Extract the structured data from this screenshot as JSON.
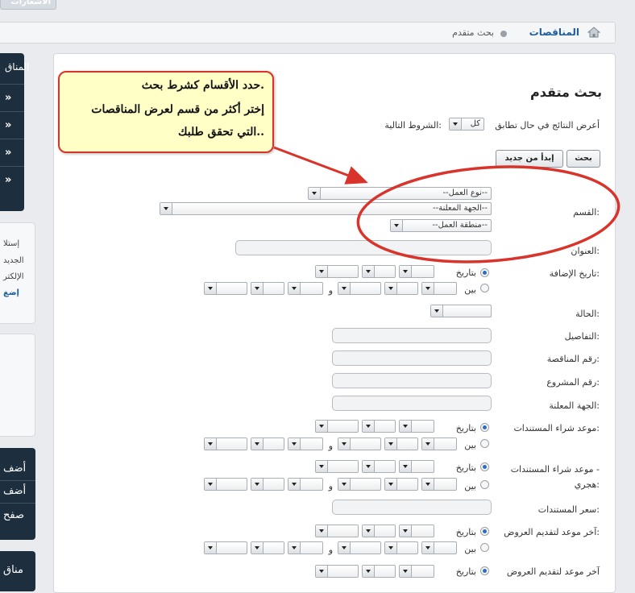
{
  "top": {
    "stub_text": "الاشعارات"
  },
  "breadcrumb": {
    "link": "المناقصات",
    "current": "بحث متقدم"
  },
  "sidebar": {
    "box1_title": "المناق",
    "box2_lines": [
      "إستلا",
      "الجديد",
      "الإلكتر"
    ],
    "box2_link": "إضغ",
    "box3_lines": [
      "أضف",
      "أضف",
      "صفح"
    ],
    "box4_title": "مناق"
  },
  "main": {
    "title": "بحث متقدم",
    "match_prefix": "أعرض النتائج في حال تطابق",
    "match_value": "كل",
    "match_suffix": "الشروط التالية:",
    "search_button": "بحث",
    "reset_button": "إبدأ من جديد",
    "labels": {
      "section": "القسم:",
      "title": "العنوان:",
      "added_date": "تاريخ الإضافة:",
      "status": "الحالة:",
      "details": "التفاصيل:",
      "tender_no": "رقم المناقصة:",
      "project_no": "رقم المشروع:",
      "issuer": "الجهة المعلنة:",
      "docs_date": "موعد شراء المستندات:",
      "docs_date_hijri_1": "موعد شراء المستندات -",
      "docs_date_hijri_2": "هجري:",
      "docs_price": "سعر المستندات:",
      "offers_deadline": "آخر موعد لتقديم العروض:",
      "offers_deadline_2": "آخر موعد لتقديم العروض"
    },
    "section_selects": [
      "--نوع العمل--",
      "--الجهة المعلنة--",
      "--منطقة العمل--"
    ],
    "radio_on_date": "بتاريخ",
    "radio_between": "بين",
    "and_label": "و"
  },
  "tooltip": {
    "line1": "حدد الأقسام كشرط بحث.",
    "line2": "إختر أكثر من قسم لعرض المناقصات",
    "line3": "التي تحقق طلبك.."
  },
  "colors": {
    "accent_red": "#d9342b",
    "tooltip_bg": "#ffffc6",
    "link_blue": "#1e5d9b",
    "sidebar_dark": "#1d2f3f"
  }
}
